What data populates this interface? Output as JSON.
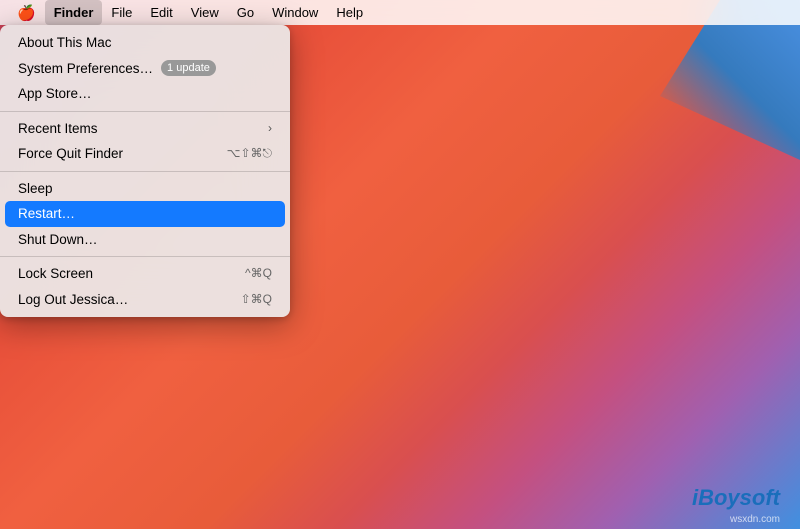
{
  "menubar": {
    "apple_icon": "🍎",
    "items": [
      {
        "label": "Finder",
        "bold": true
      },
      {
        "label": "File"
      },
      {
        "label": "Edit"
      },
      {
        "label": "View"
      },
      {
        "label": "Go"
      },
      {
        "label": "Window"
      },
      {
        "label": "Help"
      }
    ]
  },
  "dropdown": {
    "items": [
      {
        "id": "about",
        "label": "About This Mac",
        "shortcut": "",
        "type": "normal",
        "divider_after": false
      },
      {
        "id": "system-prefs",
        "label": "System Preferences…",
        "badge": "1 update",
        "type": "normal",
        "divider_after": false
      },
      {
        "id": "app-store",
        "label": "App Store…",
        "shortcut": "",
        "type": "normal",
        "divider_after": true
      },
      {
        "id": "recent-items",
        "label": "Recent Items",
        "chevron": "›",
        "type": "submenu",
        "divider_after": false
      },
      {
        "id": "force-quit",
        "label": "Force Quit Finder",
        "shortcut": "⌥⇧⌘⎋",
        "type": "normal",
        "divider_after": true
      },
      {
        "id": "sleep",
        "label": "Sleep",
        "shortcut": "",
        "type": "normal",
        "divider_after": false
      },
      {
        "id": "restart",
        "label": "Restart…",
        "shortcut": "",
        "type": "highlighted",
        "divider_after": false
      },
      {
        "id": "shutdown",
        "label": "Shut Down…",
        "shortcut": "",
        "type": "normal",
        "divider_after": true
      },
      {
        "id": "lock-screen",
        "label": "Lock Screen",
        "shortcut": "^⌘Q",
        "type": "normal",
        "divider_after": false
      },
      {
        "id": "logout",
        "label": "Log Out Jessica…",
        "shortcut": "⇧⌘Q",
        "type": "normal",
        "divider_after": false
      }
    ]
  },
  "watermark": {
    "text": "iBoysoft",
    "subtext": "wsxdn.com"
  }
}
